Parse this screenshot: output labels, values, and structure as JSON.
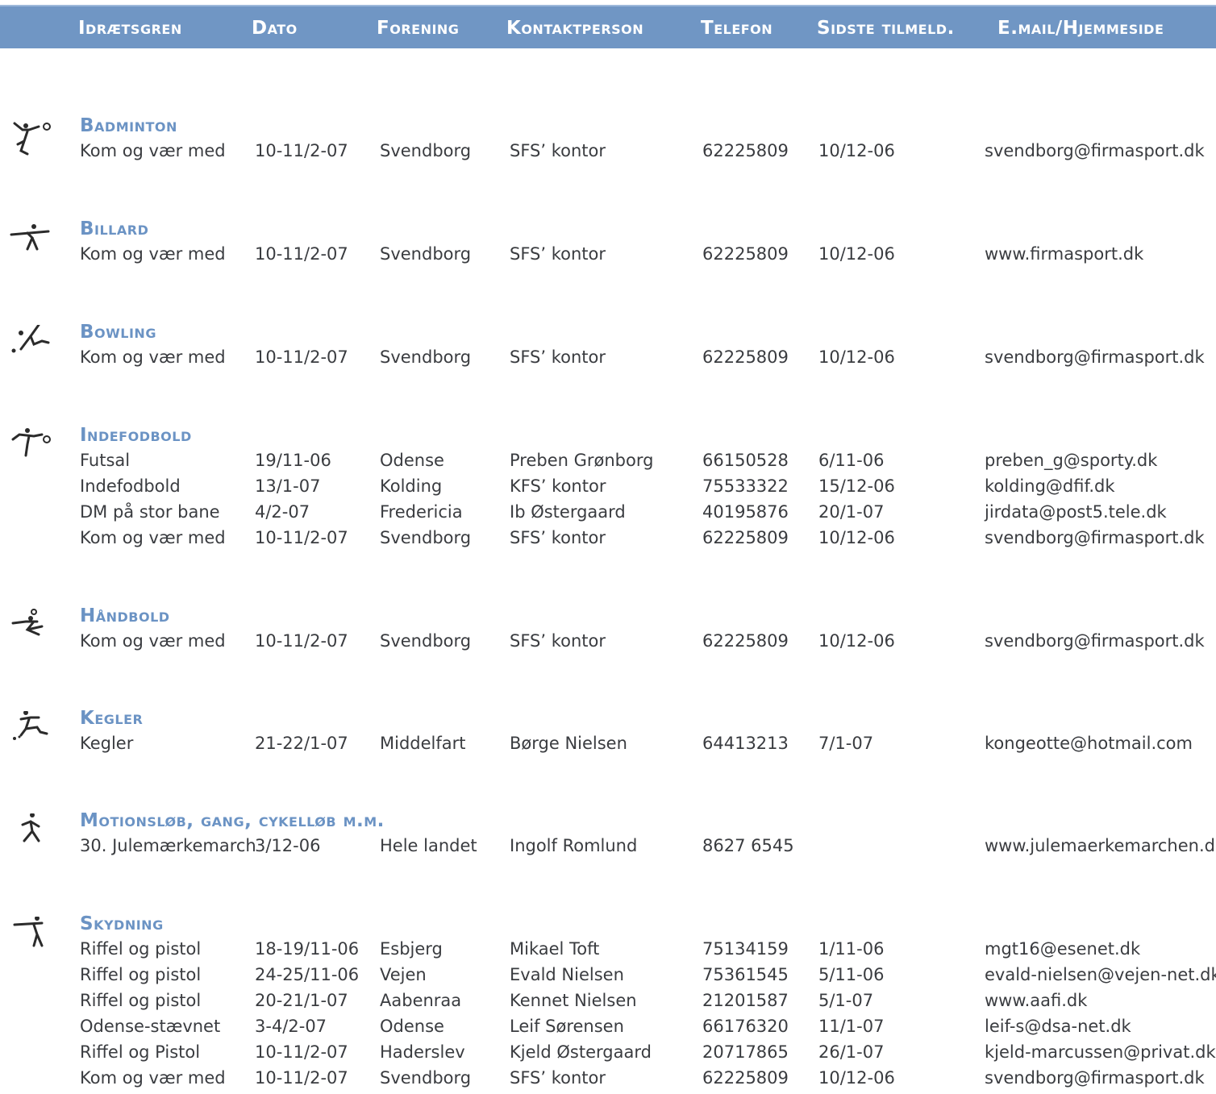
{
  "header": {
    "columns": [
      "Idrætsgren",
      "Dato",
      "Forening",
      "Kontaktperson",
      "Telefon",
      "Sidste tilmeld.",
      "E.mail/Hjemmeside"
    ]
  },
  "sections": [
    {
      "title": "Badminton",
      "icon": "badminton-icon",
      "rows": [
        [
          "Kom og vær med",
          "10-11/2-07",
          "Svendborg",
          "SFS’ kontor",
          "62225809",
          "10/12-06",
          "svendborg@firmasport.dk"
        ]
      ]
    },
    {
      "title": "Billard",
      "icon": "billiards-icon",
      "rows": [
        [
          "Kom og vær med",
          "10-11/2-07",
          "Svendborg",
          "SFS’ kontor",
          "62225809",
          "10/12-06",
          "www.firmasport.dk"
        ]
      ]
    },
    {
      "title": "Bowling",
      "icon": "bowling-icon",
      "rows": [
        [
          "Kom og vær med",
          "10-11/2-07",
          "Svendborg",
          "SFS’ kontor",
          "62225809",
          "10/12-06",
          "svendborg@firmasport.dk"
        ]
      ]
    },
    {
      "title": "Indefodbold",
      "icon": "football-icon",
      "rows": [
        [
          "Futsal",
          "19/11-06",
          "Odense",
          "Preben Grønborg",
          "66150528",
          "6/11-06",
          "preben_g@sporty.dk"
        ],
        [
          "Indefodbold",
          "13/1-07",
          "Kolding",
          "KFS’ kontor",
          "75533322",
          "15/12-06",
          "kolding@dfif.dk"
        ],
        [
          "DM på stor bane",
          "4/2-07",
          "Fredericia",
          "Ib Østergaard",
          "40195876",
          "20/1-07",
          "jirdata@post5.tele.dk"
        ],
        [
          "Kom og vær med",
          "10-11/2-07",
          "Svendborg",
          "SFS’ kontor",
          "62225809",
          "10/12-06",
          "svendborg@firmasport.dk"
        ]
      ]
    },
    {
      "title": "Håndbold",
      "icon": "handball-icon",
      "rows": [
        [
          "Kom og vær med",
          "10-11/2-07",
          "Svendborg",
          "SFS’ kontor",
          "62225809",
          "10/12-06",
          "svendborg@firmasport.dk"
        ]
      ]
    },
    {
      "title": "Kegler",
      "icon": "bowling-pins-icon",
      "rows": [
        [
          "Kegler",
          "21-22/1-07",
          "Middelfart",
          "Børge Nielsen",
          "64413213",
          "7/1-07",
          "kongeotte@hotmail.com"
        ]
      ]
    },
    {
      "title": "Motionsløb, gang, cykelløb m.m.",
      "icon": "running-icon",
      "rows": [
        [
          "30. Julemærkemarch",
          "3/12-06",
          "Hele landet",
          "Ingolf Romlund",
          "8627 6545",
          "",
          "www.julemaerkemarchen.dk"
        ]
      ]
    },
    {
      "title": "Skydning",
      "icon": "shooting-icon",
      "rows": [
        [
          "Riffel og pistol",
          "18-19/11-06",
          "Esbjerg",
          "Mikael Toft",
          "75134159",
          "1/11-06",
          "mgt16@esenet.dk"
        ],
        [
          "Riffel og pistol",
          "24-25/11-06",
          "Vejen",
          "Evald Nielsen",
          "75361545",
          "5/11-06",
          "evald-nielsen@vejen-net.dk"
        ],
        [
          "Riffel og pistol",
          "20-21/1-07",
          "Aabenraa",
          "Kennet Nielsen",
          "21201587",
          "5/1-07",
          "www.aafi.dk"
        ],
        [
          "Odense-stævnet",
          "3-4/2-07",
          "Odense",
          "Leif Sørensen",
          "66176320",
          "11/1-07",
          "leif-s@dsa-net.dk"
        ],
        [
          "Riffel og Pistol",
          "10-11/2-07",
          "Haderslev",
          "Kjeld Østergaard",
          "20717865",
          "26/1-07",
          "kjeld-marcussen@privat.dk"
        ],
        [
          "Kom og vær med",
          "10-11/2-07",
          "Svendborg",
          "SFS’ kontor",
          "62225809",
          "10/12-06",
          "svendborg@firmasport.dk"
        ]
      ]
    }
  ]
}
